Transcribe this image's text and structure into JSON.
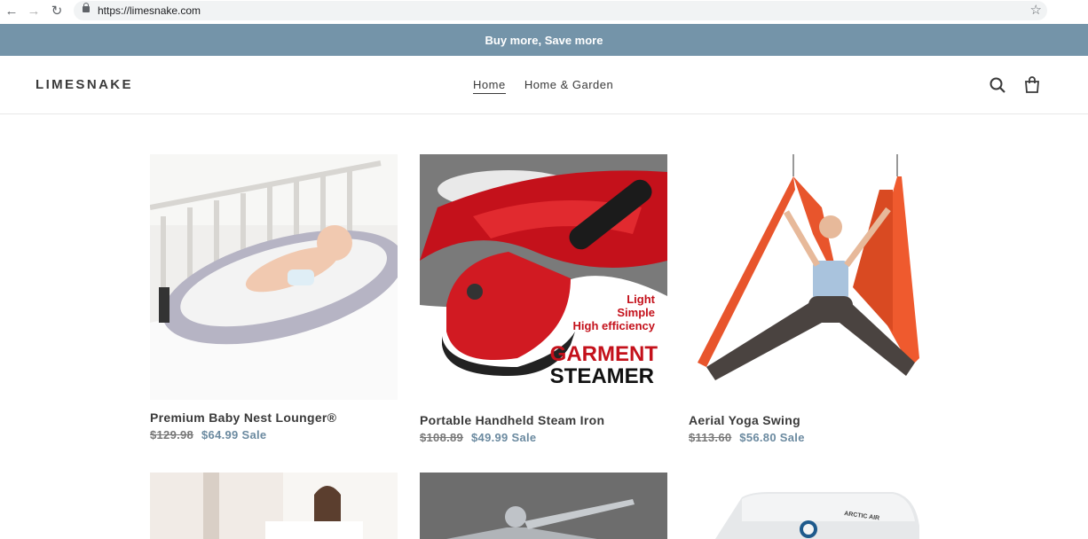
{
  "browser": {
    "url": "https://limesnake.com"
  },
  "announcement": "Buy more, Save more",
  "header": {
    "logo": "LIMESNAKE",
    "nav": [
      "Home",
      "Home & Garden"
    ]
  },
  "products": [
    {
      "title": "Premium Baby Nest Lounger®",
      "old_price": "$129.98",
      "price": "$64.99",
      "sale_label": "Sale"
    },
    {
      "title": "Portable Handheld Steam Iron",
      "old_price": "$108.89",
      "price": "$49.99",
      "sale_label": "Sale"
    },
    {
      "title": "Aerial Yoga Swing",
      "old_price": "$113.60",
      "price": "$56.80",
      "sale_label": "Sale"
    }
  ],
  "steamer_image_text": {
    "line1": "Light",
    "line2": "Simple",
    "line3": "High efficiency",
    "brand1": "GARMENT",
    "brand2": "STEAMER"
  },
  "cooler_image_text": "ARCTIC AIR",
  "colors": {
    "announcement_bg": "#7494a9",
    "sale": "#6b8aa0"
  }
}
